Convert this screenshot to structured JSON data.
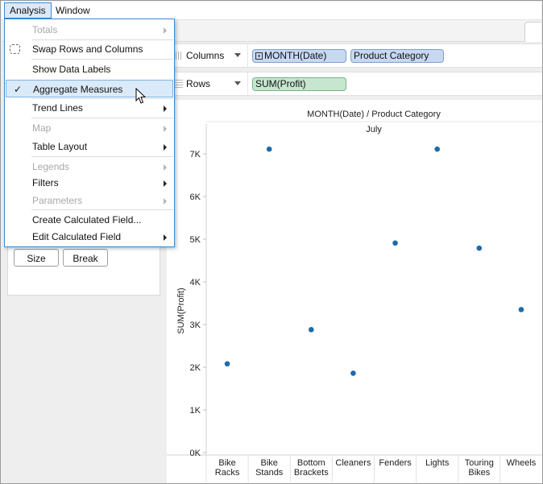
{
  "menubar": {
    "items": [
      "Analysis",
      "Window"
    ]
  },
  "analysis_menu": {
    "totals": "Totals",
    "swap_rows_columns": "Swap Rows and Columns",
    "show_data_labels": "Show Data Labels",
    "aggregate_measures": "Aggregate Measures",
    "aggregate_check": "✓",
    "trend_lines": "Trend Lines",
    "map": "Map",
    "table_layout": "Table Layout",
    "legends": "Legends",
    "filters": "Filters",
    "parameters": "Parameters",
    "create_calculated_field": "Create Calculated Field...",
    "edit_calculated_field": "Edit Calculated Field"
  },
  "marks_card": {
    "size_label": "Size",
    "break_label": "Break"
  },
  "shelves": {
    "columns_label": "Columns",
    "rows_label": "Rows",
    "columns_pills": [
      "MONTH(Date)",
      "Product Category"
    ],
    "rows_pills": [
      "SUM(Profit)"
    ]
  },
  "colors": {
    "mark": "#1f6aa8",
    "accent": "#3a87d3"
  },
  "chart_data": {
    "type": "scatter",
    "title": "MONTH(Date) / Product Category",
    "subtitle": "July",
    "ylabel": "SUM(Profit)",
    "xlabel": "",
    "categories": [
      "Bike Racks",
      "Bike Stands",
      "Bottom Brackets",
      "Cleaners",
      "Fenders",
      "Lights",
      "Touring Bikes",
      "Wheels"
    ],
    "category_lines": [
      [
        "Bike",
        "Racks"
      ],
      [
        "Bike",
        "Stands"
      ],
      [
        "Bottom",
        "Brackets"
      ],
      [
        "Cleaners"
      ],
      [
        "Fenders"
      ],
      [
        "Lights"
      ],
      [
        "Touring",
        "Bikes"
      ],
      [
        "Wheels"
      ]
    ],
    "values": [
      2080,
      7110,
      2880,
      1860,
      4910,
      7110,
      4790,
      3350
    ],
    "yticks": [
      0,
      1000,
      2000,
      3000,
      4000,
      5000,
      6000,
      7000
    ],
    "ytick_labels": [
      "0K",
      "1K",
      "2K",
      "3K",
      "4K",
      "5K",
      "6K",
      "7K"
    ],
    "ylim": [
      0,
      7300
    ]
  }
}
